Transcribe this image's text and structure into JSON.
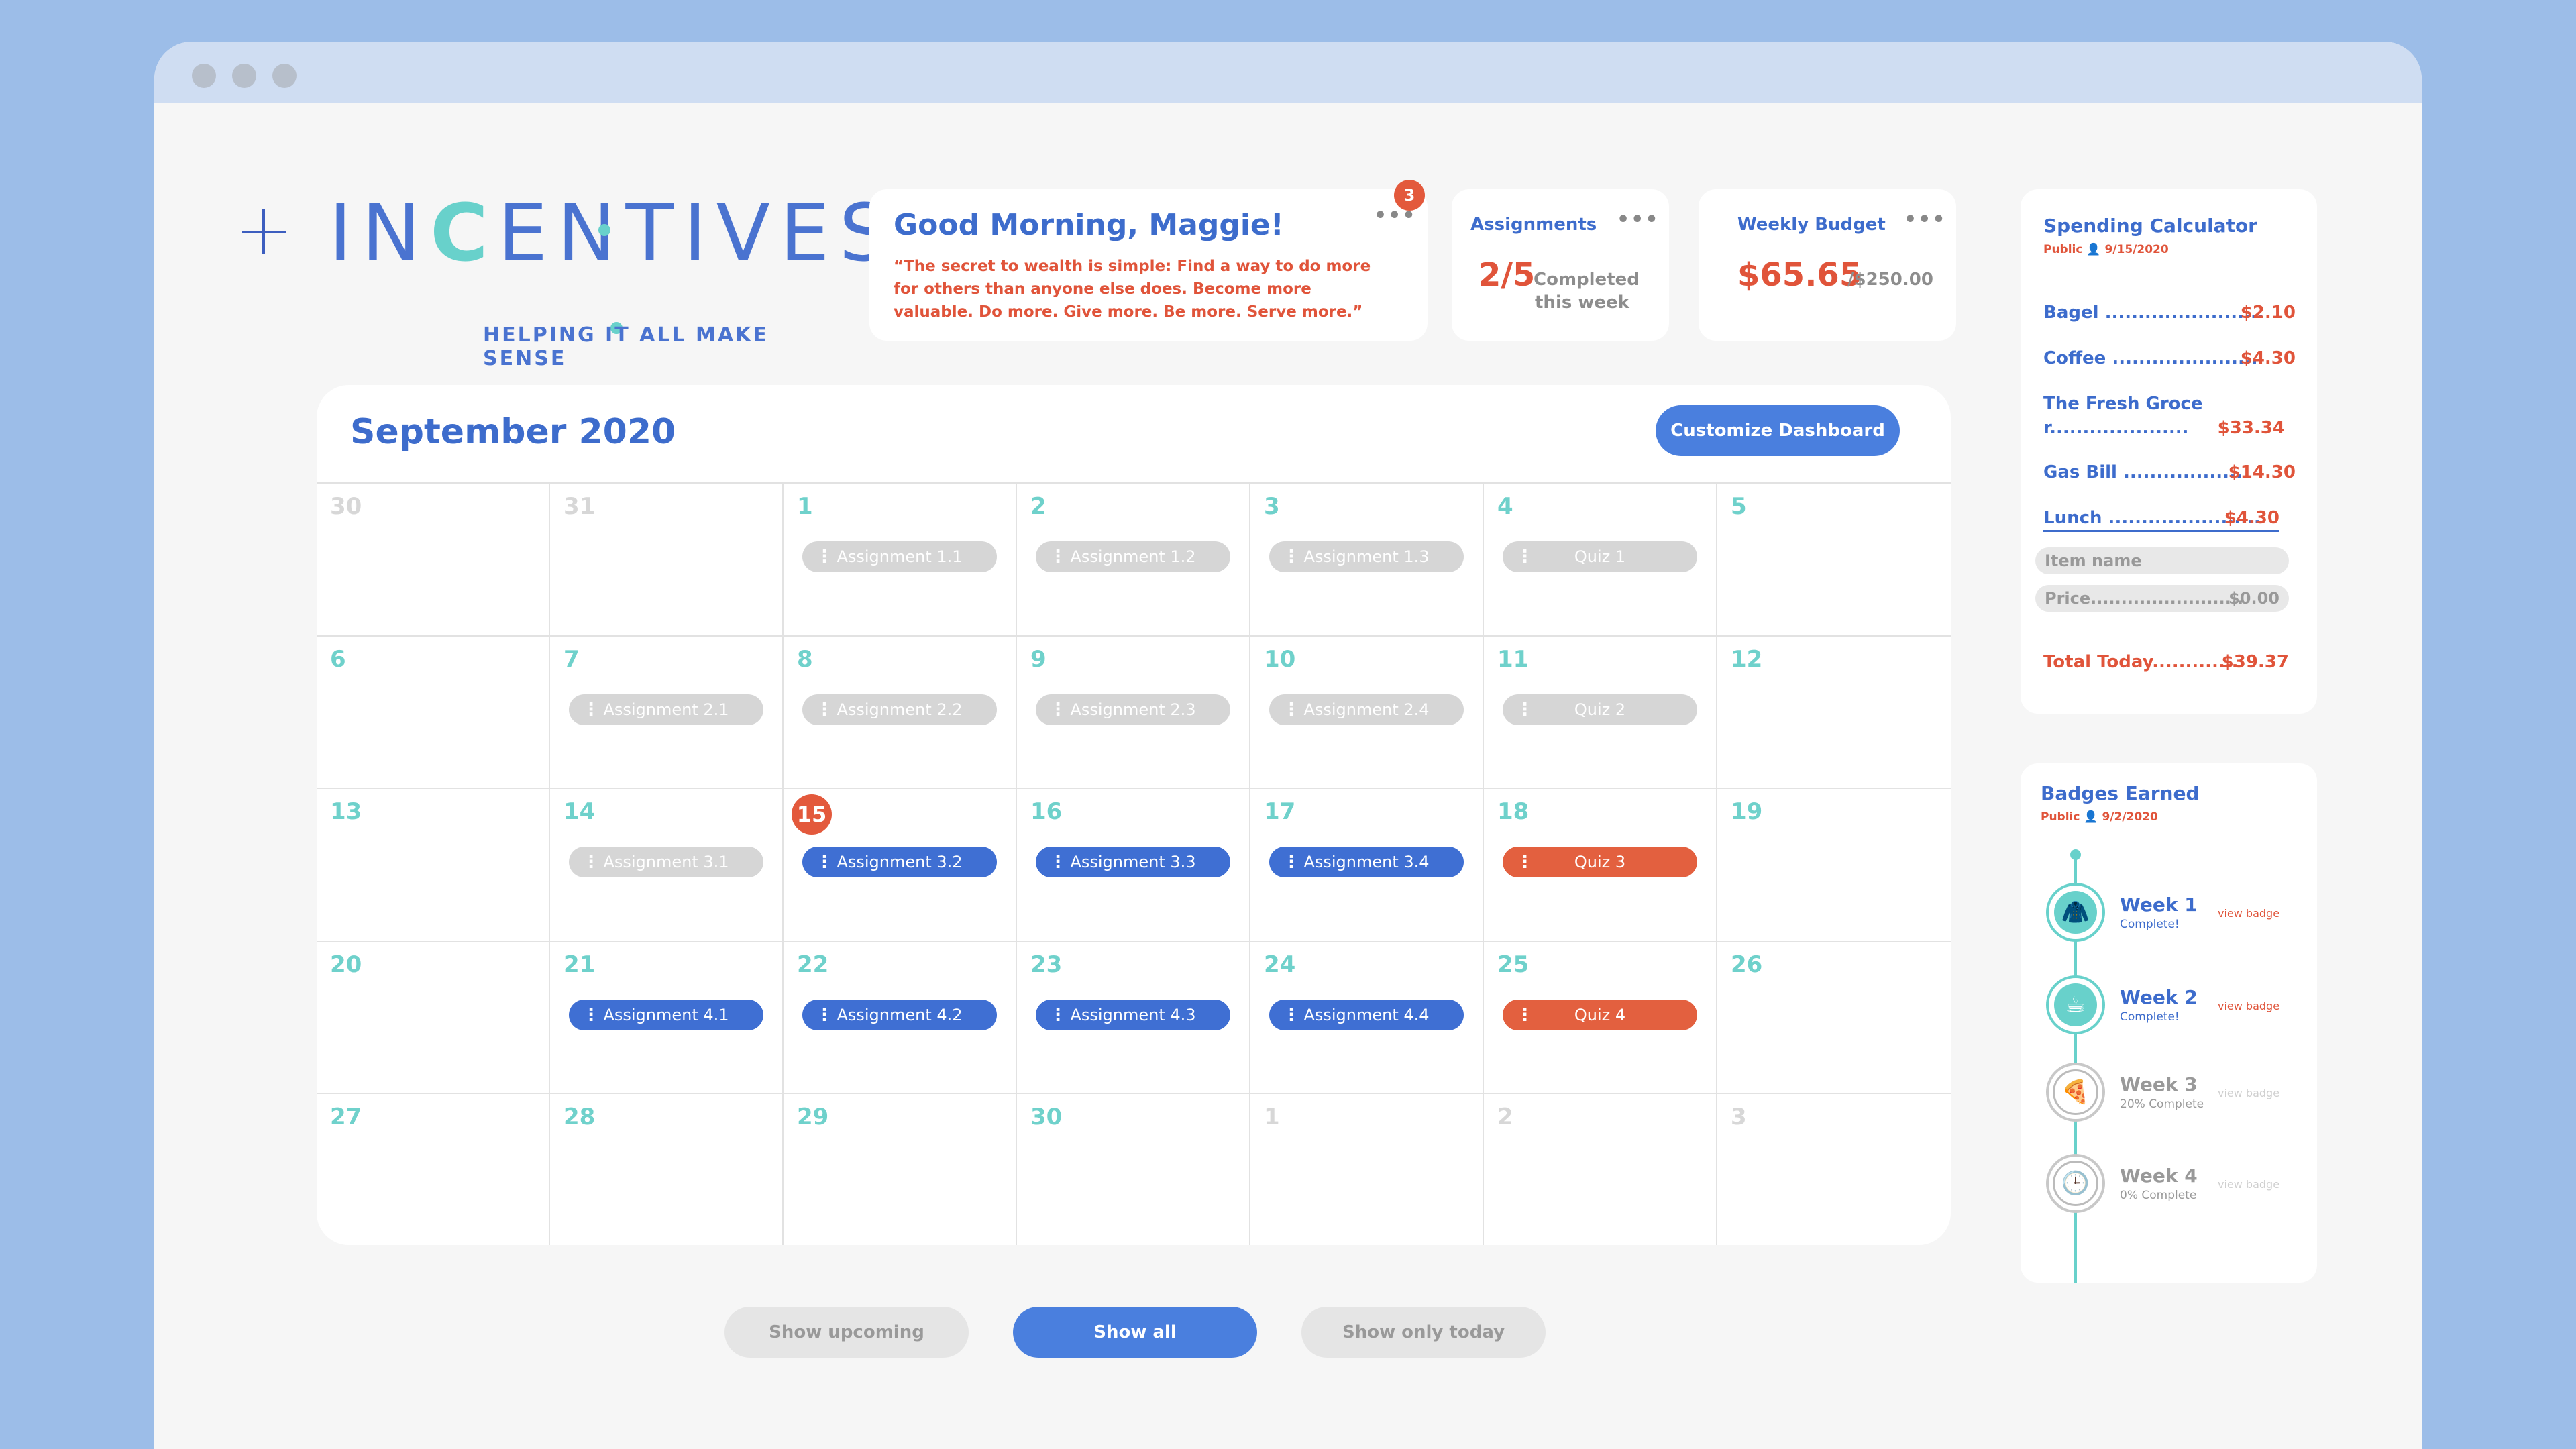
{
  "brand": {
    "name_pre": "IN",
    "name_c": "C",
    "name_post": "ENTIVES",
    "tagline": "HELPING IT ALL MAKE SENSE"
  },
  "greeting": {
    "title": "Good Morning, Maggie!",
    "quote": "“The secret to wealth is simple: Find a way to do more for others than anyone else does. Become more valuable. Do more. Give more. Be more. Serve more.”",
    "notifications": "3"
  },
  "assignments_card": {
    "title": "Assignments",
    "count": "2/5",
    "label_line1": "Completed",
    "label_line2": "this week"
  },
  "budget_card": {
    "title": "Weekly Budget",
    "spent": "$65.65",
    "total": "/$250.00"
  },
  "more_icon": "•••",
  "calendar": {
    "title": "September 2020",
    "customize_label": "Customize Dashboard",
    "weeks": [
      [
        {
          "day": "30",
          "dim": true
        },
        {
          "day": "31",
          "dim": true
        },
        {
          "day": "1",
          "event": "Assignment 1.1",
          "style": "gray"
        },
        {
          "day": "2",
          "event": "Assignment 1.2",
          "style": "gray"
        },
        {
          "day": "3",
          "event": "Assignment 1.3",
          "style": "gray"
        },
        {
          "day": "4",
          "event": "Quiz 1",
          "style": "gray"
        },
        {
          "day": "5"
        }
      ],
      [
        {
          "day": "6"
        },
        {
          "day": "7",
          "event": "Assignment 2.1",
          "style": "gray"
        },
        {
          "day": "8",
          "event": "Assignment 2.2",
          "style": "gray"
        },
        {
          "day": "9",
          "event": "Assignment 2.3",
          "style": "gray"
        },
        {
          "day": "10",
          "event": "Assignment 2.4",
          "style": "gray"
        },
        {
          "day": "11",
          "event": "Quiz 2",
          "style": "gray"
        },
        {
          "day": "12"
        }
      ],
      [
        {
          "day": "13"
        },
        {
          "day": "14",
          "event": "Assignment 3.1",
          "style": "gray"
        },
        {
          "day": "15",
          "event": "Assignment 3.2",
          "style": "blue",
          "today": true
        },
        {
          "day": "16",
          "event": "Assignment 3.3",
          "style": "blue"
        },
        {
          "day": "17",
          "event": "Assignment 3.4",
          "style": "blue"
        },
        {
          "day": "18",
          "event": "Quiz 3",
          "style": "red"
        },
        {
          "day": "19"
        }
      ],
      [
        {
          "day": "20"
        },
        {
          "day": "21",
          "event": "Assignment 4.1",
          "style": "blue"
        },
        {
          "day": "22",
          "event": "Assignment 4.2",
          "style": "blue"
        },
        {
          "day": "23",
          "event": "Assignment 4.3",
          "style": "blue"
        },
        {
          "day": "24",
          "event": "Assignment 4.4",
          "style": "blue"
        },
        {
          "day": "25",
          "event": "Quiz 4",
          "style": "red"
        },
        {
          "day": "26"
        }
      ],
      [
        {
          "day": "27"
        },
        {
          "day": "28"
        },
        {
          "day": "29"
        },
        {
          "day": "30"
        },
        {
          "day": "1",
          "dim": true
        },
        {
          "day": "2",
          "dim": true
        },
        {
          "day": "3",
          "dim": true
        }
      ]
    ]
  },
  "filters": {
    "upcoming": "Show upcoming",
    "all": "Show all",
    "today": "Show only today"
  },
  "spending": {
    "title": "Spending Calculator",
    "subtitle": "Public  👤  9/15/2020",
    "items": [
      {
        "name": "Bagel ........................",
        "price": "$2.10"
      },
      {
        "name": "Coffee ......................",
        "price": "$4.30"
      },
      {
        "name": "The Fresh Grocer.....................",
        "price": "$33.34"
      },
      {
        "name": "Gas Bill ..................",
        "price": "$14.30"
      },
      {
        "name": "Lunch .......................",
        "price": "$4.30"
      }
    ],
    "item_placeholder": "Item name",
    "price_placeholder": "Price.........................",
    "price_default": "$0.00",
    "total_label": "Total Today.............",
    "total_value": "$39.37"
  },
  "badges": {
    "title": "Badges Earned",
    "subtitle": "Public  👤  9/2/2020",
    "view_label": "view badge",
    "weeks": [
      {
        "title": "Week 1",
        "status": "Complete!",
        "icon": "🧥",
        "done": true
      },
      {
        "title": "Week 2",
        "status": "Complete!",
        "icon": "☕",
        "done": true
      },
      {
        "title": "Week 3",
        "status": "20% Complete",
        "icon": "🍕",
        "done": false
      },
      {
        "title": "Week 4",
        "status": "0% Complete",
        "icon": "🕒",
        "done": false
      }
    ]
  },
  "colors": {
    "accent_blue": "#3f6fd3",
    "accent_red": "#e3603f",
    "teal": "#68d1cb",
    "page_bg": "#9cbde8"
  }
}
